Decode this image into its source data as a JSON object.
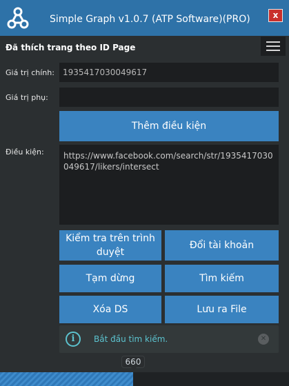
{
  "window": {
    "title": "Simple Graph v1.0.7 (ATP Software)(PRO)",
    "logo_icon": "graph-nodes-icon",
    "close_label": "x"
  },
  "header": {
    "page_title": "Đã thích trang theo ID Page",
    "menu_icon": "hamburger-icon"
  },
  "form": {
    "main_value_label": "Giá trị chính:",
    "main_value": "1935417030049617",
    "sub_value_label": "Giá trị phụ:",
    "sub_value": "",
    "add_condition_button": "Thêm điều kiện",
    "condition_label": "Điều kiện:",
    "condition_value": "https://www.facebook.com/search/str/1935417030049617/likers/intersect"
  },
  "actions": {
    "check_browser": "Kiểm tra trên trình duyệt",
    "switch_account": "Đổi tài khoản",
    "pause": "Tạm dừng",
    "search": "Tìm kiếm",
    "clear_list": "Xóa DS",
    "save_file": "Lưu ra File"
  },
  "notification": {
    "icon": "info-icon",
    "text": "Bắt đầu tìm kiếm.",
    "dismiss_icon": "close-circle-icon"
  },
  "progress": {
    "value": "660",
    "fraction": 0.46
  },
  "colors": {
    "titlebar": "#2e72a8",
    "background": "#2b2f31",
    "button": "#3a83c0",
    "field": "#1c1e20",
    "close": "#c9302c",
    "notify_text": "#5cc3cf"
  }
}
